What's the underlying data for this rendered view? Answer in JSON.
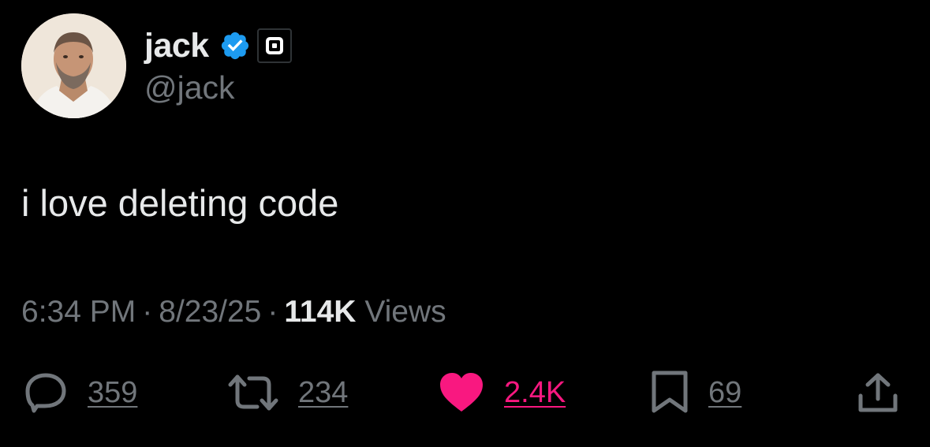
{
  "user": {
    "display_name": "jack",
    "handle": "@jack",
    "verified": true,
    "avatar": "profile-photo"
  },
  "tweet": {
    "text": "i love deleting code",
    "time": "6:34 PM",
    "separator": "·",
    "date": "8/23/25",
    "views_count": "114K",
    "views_label": "Views"
  },
  "actions": {
    "replies": "359",
    "reposts": "234",
    "likes": "2.4K",
    "likes_active": true,
    "bookmarks": "69"
  },
  "colors": {
    "background": "#000000",
    "primary_text": "#e7e9ea",
    "secondary_text": "#71767b",
    "verified_blue": "#1d9bf0",
    "like_pink": "#f91880"
  },
  "icons": {
    "reply": "reply-icon",
    "repost": "repost-icon",
    "like": "heart-icon",
    "bookmark": "bookmark-icon",
    "share": "share-icon",
    "verified": "verified-badge-icon",
    "affiliate": "affiliate-badge-icon"
  }
}
